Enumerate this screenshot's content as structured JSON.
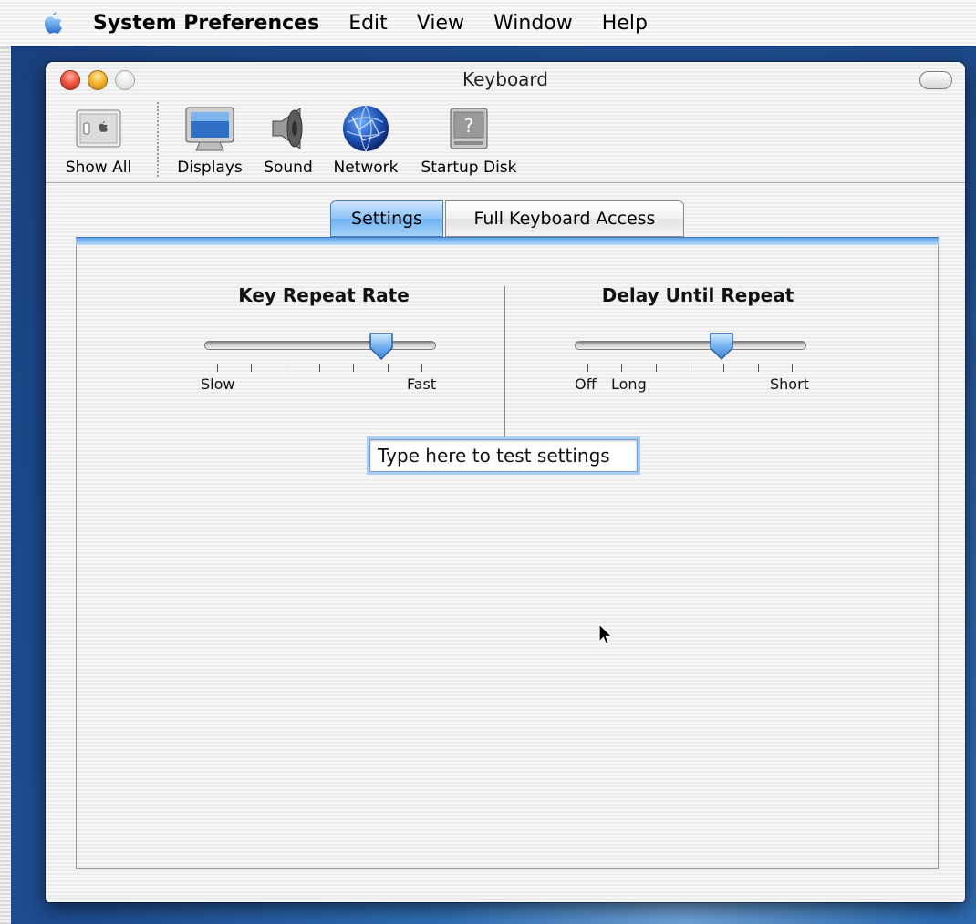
{
  "menubar": {
    "apple_icon": "apple-logo-icon",
    "app_name": "System Preferences",
    "items": [
      "Edit",
      "View",
      "Window",
      "Help"
    ]
  },
  "window": {
    "title": "Keyboard"
  },
  "toolbar": {
    "items": [
      {
        "label": "Show All",
        "icon": "show-all-icon"
      },
      {
        "label": "Displays",
        "icon": "displays-icon"
      },
      {
        "label": "Sound",
        "icon": "sound-speaker-icon"
      },
      {
        "label": "Network",
        "icon": "network-globe-icon"
      },
      {
        "label": "Startup Disk",
        "icon": "startup-disk-icon"
      }
    ]
  },
  "tabs": [
    {
      "label": "Settings",
      "selected": true
    },
    {
      "label": "Full Keyboard Access",
      "selected": false
    }
  ],
  "key_repeat": {
    "title": "Key Repeat Rate",
    "min_label": "Slow",
    "max_label": "Fast",
    "value_fraction": 0.8
  },
  "delay_repeat": {
    "title": "Delay Until Repeat",
    "off_label": "Off",
    "long_label": "Long",
    "short_label": "Short",
    "value_fraction": 0.65
  },
  "test_field": {
    "value": "Type here to test settings"
  },
  "colors": {
    "accent": "#6eb0f0",
    "desktop": "#1f4f93"
  }
}
